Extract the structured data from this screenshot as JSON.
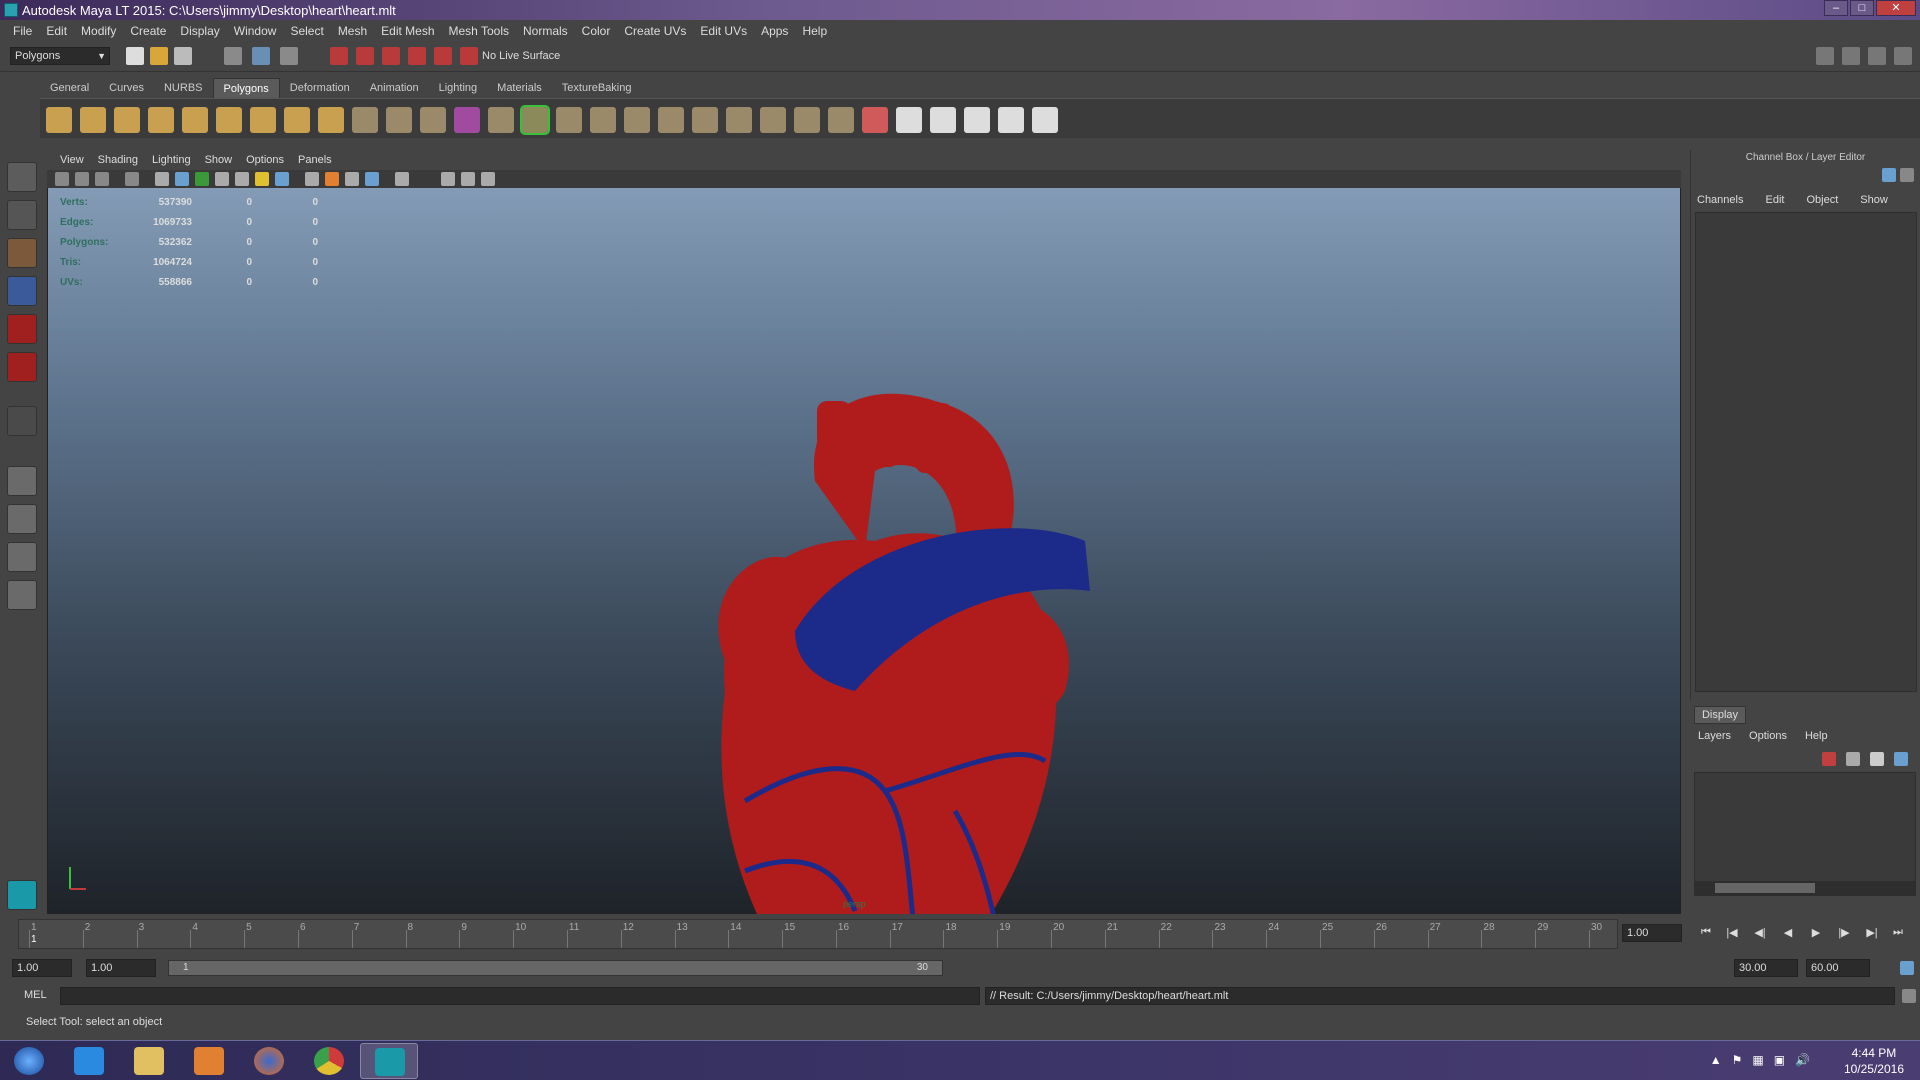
{
  "window": {
    "title": "Autodesk Maya LT 2015: C:\\Users\\jimmy\\Desktop\\heart\\heart.mlt"
  },
  "menubar": [
    "File",
    "Edit",
    "Modify",
    "Create",
    "Display",
    "Window",
    "Select",
    "Mesh",
    "Edit Mesh",
    "Mesh Tools",
    "Normals",
    "Color",
    "Create UVs",
    "Edit UVs",
    "Apps",
    "Help"
  ],
  "statusline": {
    "menu_set": "Polygons",
    "live_surface": "No Live Surface"
  },
  "shelf": {
    "tabs": [
      "General",
      "Curves",
      "NURBS",
      "Polygons",
      "Deformation",
      "Animation",
      "Lighting",
      "Materials",
      "TextureBaking"
    ],
    "active_tab": "Polygons"
  },
  "viewport": {
    "menu": [
      "View",
      "Shading",
      "Lighting",
      "Show",
      "Options",
      "Panels"
    ],
    "hud": [
      {
        "label": "Verts:",
        "total": "537390",
        "sel": "0",
        "comp": "0"
      },
      {
        "label": "Edges:",
        "total": "1069733",
        "sel": "0",
        "comp": "0"
      },
      {
        "label": "Polygons:",
        "total": "532362",
        "sel": "0",
        "comp": "0"
      },
      {
        "label": "Tris:",
        "total": "1064724",
        "sel": "0",
        "comp": "0"
      },
      {
        "label": "UVs:",
        "total": "558866",
        "sel": "0",
        "comp": "0"
      }
    ],
    "camera_label": "persp",
    "colors": {
      "heart": "#b01c1c",
      "vessels": "#1c2a8a"
    }
  },
  "channel_box": {
    "header": "Channel Box / Layer Editor",
    "menu": [
      "Channels",
      "Edit",
      "Object",
      "Show"
    ]
  },
  "layer_editor": {
    "tab": "Display",
    "menu": [
      "Layers",
      "Options",
      "Help"
    ]
  },
  "timeslider": {
    "ticks": [
      "1",
      "2",
      "3",
      "4",
      "5",
      "6",
      "7",
      "8",
      "9",
      "10",
      "11",
      "12",
      "13",
      "14",
      "15",
      "16",
      "17",
      "18",
      "19",
      "20",
      "21",
      "22",
      "23",
      "24",
      "25",
      "26",
      "27",
      "28",
      "29",
      "30"
    ],
    "current_frame": "1.00",
    "current_marker": "1"
  },
  "rangeslider": {
    "start": "1.00",
    "playback_start": "1.00",
    "range_start": "1",
    "range_end": "30",
    "playback_end": "30.00",
    "end": "60.00"
  },
  "cmdline": {
    "label": "MEL",
    "result": "// Result: C:/Users/jimmy/Desktop/heart/heart.mlt"
  },
  "helpline": "Select Tool: select an object",
  "taskbar": {
    "time": "4:44 PM",
    "date": "10/25/2016"
  }
}
